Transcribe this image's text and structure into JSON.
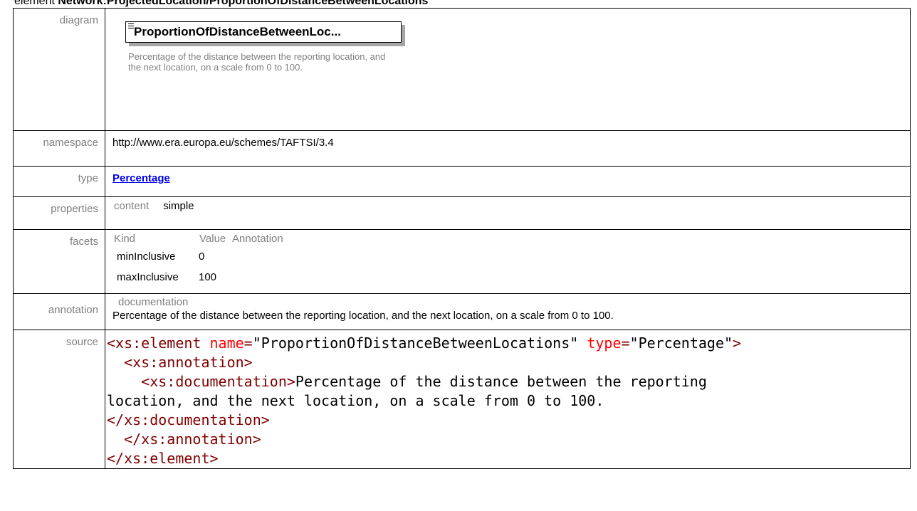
{
  "heading": {
    "prefix": "element",
    "name": "Network:ProjectedLocation/ProportionOfDistanceBetweenLocations"
  },
  "labels": {
    "diagram": "diagram",
    "namespace": "namespace",
    "type": "type",
    "properties": "properties",
    "facets": "facets",
    "annotation": "annotation",
    "source": "source"
  },
  "diagram": {
    "box_title": "ProportionOfDistanceBetweenLoc...",
    "doc": "Percentage of the distance between the reporting location, and the next location, on a scale from 0 to 100."
  },
  "namespace": "http://www.era.europa.eu/schemes/TAFTSI/3.4",
  "type_link": "Percentage",
  "properties": {
    "key": "content",
    "value": "simple"
  },
  "facets": {
    "headers": [
      "Kind",
      "Value",
      "Annotation"
    ],
    "rows": [
      {
        "kind": "minInclusive",
        "value": "0"
      },
      {
        "kind": "maxInclusive",
        "value": "100"
      }
    ]
  },
  "annotation": {
    "key": "documentation",
    "text": "Percentage of the distance between the reporting location, and the next location, on a scale from 0 to 100."
  },
  "source": {
    "open_tag": "<xs:element",
    "attr_name": "name",
    "name_value": "\"ProportionOfDistanceBetweenLocations\"",
    "attr_type": "type",
    "type_value": "\"Percentage\"",
    "gt": ">",
    "annotation_open": "<xs:annotation>",
    "doc_open": "<xs:documentation>",
    "doc_text_1": "Percentage of the distance between the reporting",
    "doc_text_2": "location, and the next location, on a scale from 0 to 100.",
    "doc_close": "</xs:documentation>",
    "annotation_close": "</xs:annotation>",
    "element_close": "</xs:element>"
  }
}
